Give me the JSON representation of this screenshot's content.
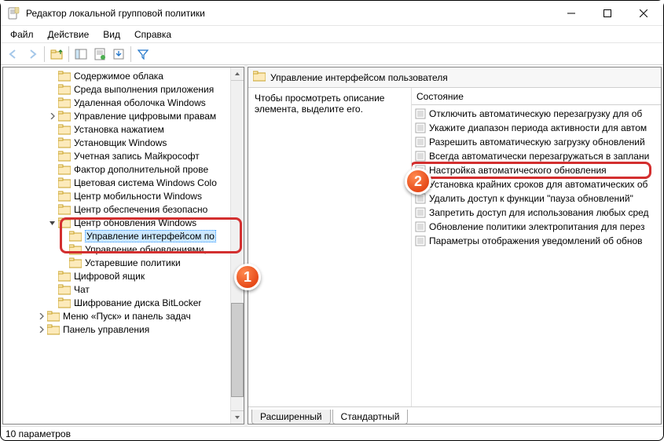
{
  "window": {
    "title": "Редактор локальной групповой политики"
  },
  "menu": {
    "file": "Файл",
    "action": "Действие",
    "view": "Вид",
    "help": "Справка"
  },
  "tree": {
    "items": [
      {
        "indent": 5,
        "toggle": "",
        "label": "Содержимое облака"
      },
      {
        "indent": 5,
        "toggle": "",
        "label": "Среда выполнения приложения"
      },
      {
        "indent": 5,
        "toggle": "",
        "label": "Удаленная оболочка Windows"
      },
      {
        "indent": 5,
        "toggle": ">",
        "label": "Управление цифровыми правам"
      },
      {
        "indent": 5,
        "toggle": "",
        "label": "Установка нажатием"
      },
      {
        "indent": 5,
        "toggle": "",
        "label": "Установщик Windows"
      },
      {
        "indent": 5,
        "toggle": "",
        "label": "Учетная запись Майкрософт"
      },
      {
        "indent": 5,
        "toggle": "",
        "label": "Фактор дополнительной прове"
      },
      {
        "indent": 5,
        "toggle": "",
        "label": "Цветовая система Windows Colo"
      },
      {
        "indent": 5,
        "toggle": "",
        "label": "Центр мобильности Windows"
      },
      {
        "indent": 5,
        "toggle": "",
        "label": "Центр обеспечения безопасно"
      },
      {
        "indent": 5,
        "toggle": "v",
        "label": "Центр обновления Windows"
      },
      {
        "indent": 6,
        "toggle": "",
        "label": "Управление интерфейсом по",
        "selected": true
      },
      {
        "indent": 6,
        "toggle": "",
        "label": "Управление обновлениями,"
      },
      {
        "indent": 6,
        "toggle": "",
        "label": "Устаревшие политики"
      },
      {
        "indent": 5,
        "toggle": "",
        "label": "Цифровой ящик"
      },
      {
        "indent": 5,
        "toggle": "",
        "label": "Чат"
      },
      {
        "indent": 5,
        "toggle": "",
        "label": "Шифрование диска BitLocker"
      },
      {
        "indent": 4,
        "toggle": ">",
        "label": "Меню «Пуск» и панель задач"
      },
      {
        "indent": 4,
        "toggle": ">",
        "label": "Панель управления"
      }
    ]
  },
  "content": {
    "header_title": "Управление интерфейсом пользователя",
    "description": "Чтобы просмотреть описание элемента, выделите его.",
    "column_header": "Состояние",
    "items": [
      "Отключить автоматическую перезагрузку для об",
      "Укажите диапазон периода активности для автом",
      "Разрешить автоматическую загрузку обновлений",
      "Всегда автоматически перезагружаться в заплани",
      "Настройка автоматического обновления",
      "Установка крайних сроков для автоматических об",
      "Удалить доступ к функции \"пауза обновлений\"",
      "Запретить доступ для использования любых сред",
      "Обновление политики электропитания для перез",
      "Параметры отображения уведомлений об обнов"
    ],
    "tabs": {
      "extended": "Расширенный",
      "standard": "Стандартный"
    }
  },
  "status": {
    "text": "10 параметров"
  },
  "badges": {
    "one": "1",
    "two": "2"
  }
}
